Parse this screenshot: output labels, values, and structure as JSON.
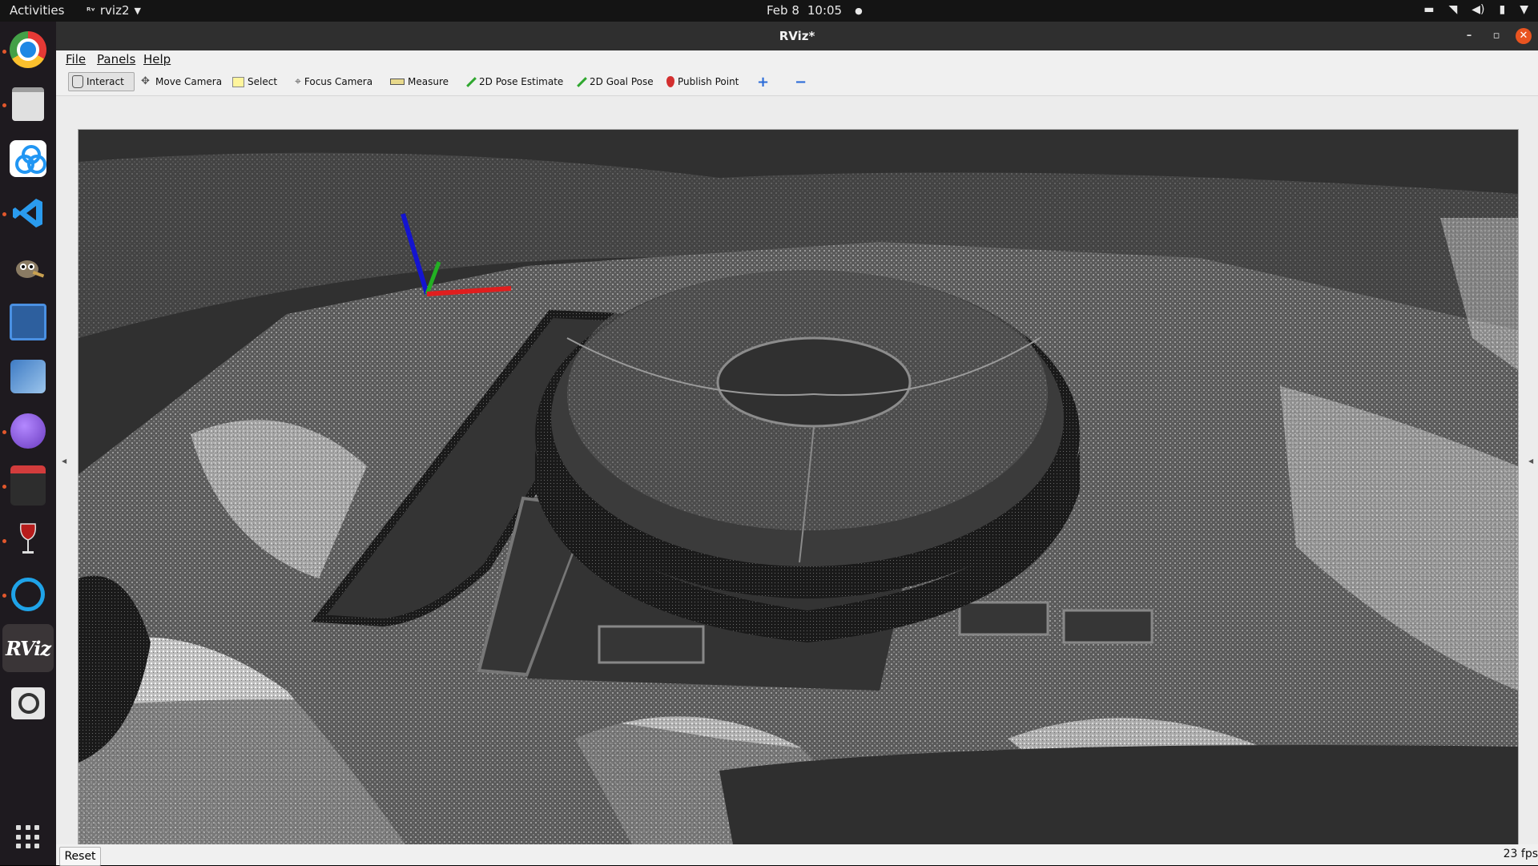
{
  "topbar": {
    "activities": "Activities",
    "app_name": "rviz2",
    "date": "Feb 8",
    "time": "10:05"
  },
  "dock": {
    "items": [
      {
        "name": "chrome"
      },
      {
        "name": "files"
      },
      {
        "name": "baidu-netdisk"
      },
      {
        "name": "vscode"
      },
      {
        "name": "gimp"
      },
      {
        "name": "screenshot"
      },
      {
        "name": "control-center"
      },
      {
        "name": "browser-globe"
      },
      {
        "name": "terminal"
      },
      {
        "name": "wine"
      },
      {
        "name": "search-app"
      },
      {
        "name": "rviz"
      },
      {
        "name": "magnifier"
      },
      {
        "name": "app-grid"
      }
    ],
    "rviz_label": "RViz"
  },
  "window": {
    "title": "RViz*"
  },
  "menu": {
    "file": "File",
    "panels": "Panels",
    "help": "Help"
  },
  "toolbar": {
    "interact": "Interact",
    "move_camera": "Move Camera",
    "select": "Select",
    "focus_camera": "Focus Camera",
    "measure": "Measure",
    "pose_estimate": "2D Pose Estimate",
    "goal_pose": "2D Goal Pose",
    "publish_point": "Publish Point"
  },
  "status": {
    "reset": "Reset",
    "fps": "23 fps"
  },
  "colors": {
    "axis_x": "#e02020",
    "axis_y": "#20b020",
    "axis_z": "#1010d0",
    "background": "#303030"
  }
}
